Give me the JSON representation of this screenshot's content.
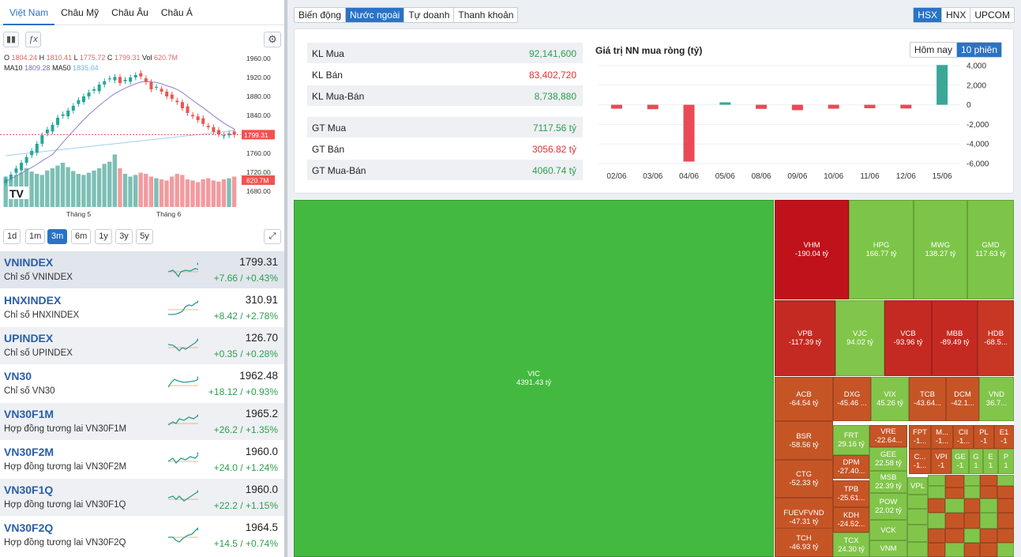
{
  "markets": {
    "tabs": [
      "Việt Nam",
      "Châu Mỹ",
      "Châu Âu",
      "Châu Á"
    ]
  },
  "ohlc": {
    "o_label": "O",
    "o": "1804.24",
    "h_label": "H",
    "h": "1810.41",
    "l_label": "L",
    "l": "1775.72",
    "c_label": "C",
    "c": "1799.31",
    "vol_label": "Vol",
    "vol": "620.7M",
    "ma10_label": "MA10",
    "ma10": "1809.28",
    "ma50_label": "MA50",
    "ma50": "1835.04"
  },
  "chart_data": {
    "type": "candlestick",
    "title": "",
    "y_ticks": [
      "1960.00",
      "1920.00",
      "1880.00",
      "1840.00",
      "1800.00",
      "1760.00",
      "1720.00",
      "1680.00"
    ],
    "ylim": [
      1680,
      1960
    ],
    "x_labels": [
      "Tháng 5",
      "Tháng 6"
    ],
    "last_price": "1799.31",
    "last_volume": "620.7M",
    "closes": [
      1705,
      1715,
      1728,
      1740,
      1752,
      1765,
      1780,
      1798,
      1810,
      1820,
      1835,
      1842,
      1850,
      1860,
      1872,
      1880,
      1888,
      1895,
      1905,
      1912,
      1918,
      1921,
      1908,
      1915,
      1920,
      1925,
      1922,
      1910,
      1895,
      1900,
      1890,
      1880,
      1875,
      1868,
      1855,
      1845,
      1838,
      1830,
      1822,
      1815,
      1805,
      1800,
      1798,
      1802,
      1799
    ],
    "volumes": [
      0.55,
      0.5,
      0.58,
      0.62,
      0.7,
      0.64,
      0.6,
      0.58,
      0.66,
      0.7,
      0.75,
      0.8,
      0.72,
      0.65,
      0.6,
      0.58,
      0.62,
      0.66,
      0.7,
      0.78,
      0.82,
      0.95,
      0.7,
      0.6,
      0.55,
      0.58,
      0.62,
      0.6,
      0.55,
      0.52,
      0.5,
      0.48,
      0.55,
      0.6,
      0.58,
      0.5,
      0.48,
      0.45,
      0.5,
      0.52,
      0.48,
      0.46,
      0.5,
      0.52,
      0.55
    ]
  },
  "ranges": [
    "1d",
    "1m",
    "3m",
    "6m",
    "1y",
    "3y",
    "5y"
  ],
  "indices": [
    {
      "name": "VNINDEX",
      "desc": "Chỉ số VNINDEX",
      "value": "1799.31",
      "change": "+7.66 / +0.43%"
    },
    {
      "name": "HNXINDEX",
      "desc": "Chỉ số HNXINDEX",
      "value": "310.91",
      "change": "+8.42 / +2.78%"
    },
    {
      "name": "UPINDEX",
      "desc": "Chỉ số UPINDEX",
      "value": "126.70",
      "change": "+0.35 / +0.28%"
    },
    {
      "name": "VN30",
      "desc": "Chỉ số VN30",
      "value": "1962.48",
      "change": "+18.12 / +0.93%"
    },
    {
      "name": "VN30F1M",
      "desc": "Hợp đồng tương lai VN30F1M",
      "value": "1965.2",
      "change": "+26.2 / +1.35%"
    },
    {
      "name": "VN30F2M",
      "desc": "Hợp đồng tương lai VN30F2M",
      "value": "1960.0",
      "change": "+24.0 / +1.24%"
    },
    {
      "name": "VN30F1Q",
      "desc": "Hợp đồng tương lai VN30F1Q",
      "value": "1960.0",
      "change": "+22.2 / +1.15%"
    },
    {
      "name": "VN30F2Q",
      "desc": "Hợp đồng tương lai VN30F2Q",
      "value": "1964.5",
      "change": "+14.5 / +0.74%"
    }
  ],
  "section_tabs": [
    "Biến động",
    "Nước ngoài",
    "Tự doanh",
    "Thanh khoản"
  ],
  "exchange_tabs": [
    "HSX",
    "HNX",
    "UPCOM"
  ],
  "foreign": {
    "kl_mua_label": "KL Mua",
    "kl_mua": "92,141,600",
    "kl_ban_label": "KL Bán",
    "kl_ban": "83,402,720",
    "kl_net_label": "KL Mua-Bán",
    "kl_net": "8,738,880",
    "gt_mua_label": "GT Mua",
    "gt_mua": "7117.56 tỷ",
    "gt_ban_label": "GT Bán",
    "gt_ban": "3056.82 tỷ",
    "gt_net_label": "GT Mua-Bán",
    "gt_net": "4060.74 tỷ"
  },
  "net_chart": {
    "title": "Giá trị NN mua ròng (tỷ)",
    "period_tabs": [
      "Hôm nay",
      "10 phiên"
    ]
  },
  "net_chart_data": {
    "type": "bar",
    "categories": [
      "02/06",
      "03/06",
      "04/06",
      "05/06",
      "08/06",
      "09/06",
      "10/06",
      "11/06",
      "12/06",
      "15/06"
    ],
    "values": [
      -400,
      -450,
      -5800,
      250,
      -420,
      -550,
      -400,
      -350,
      -380,
      4060
    ],
    "ylim": [
      -6000,
      4000
    ],
    "y_ticks": [
      "4,000",
      "2,000",
      "0",
      "-2,000",
      "-4,000",
      "-6,000"
    ]
  },
  "treemap": [
    {
      "code": "VIC",
      "val": "4391.43 tỷ",
      "color": "#44b940"
    },
    {
      "code": "VHM",
      "val": "-190.04 tỷ",
      "color": "#c0121a"
    },
    {
      "code": "HPG",
      "val": "166.77 tỷ",
      "color": "#7cc548"
    },
    {
      "code": "MWG",
      "val": "138.27 tỷ",
      "color": "#7cc548"
    },
    {
      "code": "GMD",
      "val": "117.63 tỷ",
      "color": "#7cc548"
    },
    {
      "code": "VPB",
      "val": "-117.39 tỷ",
      "color": "#c42a21"
    },
    {
      "code": "VJC",
      "val": "94.02 tỷ",
      "color": "#82c54b"
    },
    {
      "code": "VCB",
      "val": "-93.96 tỷ",
      "color": "#c42a21"
    },
    {
      "code": "MBB",
      "val": "-89.49 tỷ",
      "color": "#c42a21"
    },
    {
      "code": "HDB",
      "val": "-68.5...",
      "color": "#c83724"
    },
    {
      "code": "ACB",
      "val": "-64.54 tỷ",
      "color": "#c65526"
    },
    {
      "code": "DXG",
      "val": "-45.46 ...",
      "color": "#c65526"
    },
    {
      "code": "VIX",
      "val": "45.26 tỷ",
      "color": "#82c54b"
    },
    {
      "code": "TCB",
      "val": "-43.64...",
      "color": "#c65526"
    },
    {
      "code": "DCM",
      "val": "-42.1...",
      "color": "#c65526"
    },
    {
      "code": "VND",
      "val": "36.7...",
      "color": "#82c54b"
    },
    {
      "code": "BSR",
      "val": "-58.56 tỷ",
      "color": "#c65526"
    },
    {
      "code": "FRT",
      "val": "29.16 tỷ",
      "color": "#82c54b"
    },
    {
      "code": "VRE",
      "val": "-22.64...",
      "color": "#c65526"
    },
    {
      "code": "FPT",
      "val": "-1...",
      "color": "#c65526"
    },
    {
      "code": "M...",
      "val": "-1...",
      "color": "#c65526"
    },
    {
      "code": "CII",
      "val": "-1...",
      "color": "#c65526"
    },
    {
      "code": "PL",
      "val": "-1",
      "color": "#c65526"
    },
    {
      "code": "E1",
      "val": "-1",
      "color": "#c65526"
    },
    {
      "code": "GEE",
      "val": "22.58 tỷ",
      "color": "#82c54b"
    },
    {
      "code": "DPM",
      "val": "-27.40...",
      "color": "#c65526"
    },
    {
      "code": "C...",
      "val": "-1...",
      "color": "#c65526"
    },
    {
      "code": "VPI",
      "val": "-1",
      "color": "#c65526"
    },
    {
      "code": "GE",
      "val": "-1",
      "color": "#82c54b"
    },
    {
      "code": "G",
      "val": "1",
      "color": "#82c54b"
    },
    {
      "code": "E",
      "val": "1",
      "color": "#82c54b"
    },
    {
      "code": "P",
      "val": "1",
      "color": "#82c54b"
    },
    {
      "code": "CTG",
      "val": "-52.33 tỷ",
      "color": "#c65526"
    },
    {
      "code": "MSB",
      "val": "22.39 tỷ",
      "color": "#82c54b"
    },
    {
      "code": "TPB",
      "val": "-25.61...",
      "color": "#c65526"
    },
    {
      "code": "VPL",
      "val": "",
      "color": "#82c54b"
    },
    {
      "code": "FUEVFVND",
      "val": "-47.31 tỷ",
      "color": "#c65526"
    },
    {
      "code": "POW",
      "val": "22.02 tỷ",
      "color": "#82c54b"
    },
    {
      "code": "KDH",
      "val": "-24.52...",
      "color": "#c65526"
    },
    {
      "code": "VCK",
      "val": "",
      "color": "#82c54b"
    },
    {
      "code": "TCH",
      "val": "-46.93 tỷ",
      "color": "#c65526"
    },
    {
      "code": "TCX",
      "val": "24.30 tỷ",
      "color": "#82c54b"
    },
    {
      "code": "VNM",
      "val": "",
      "color": "#82c54b"
    }
  ]
}
